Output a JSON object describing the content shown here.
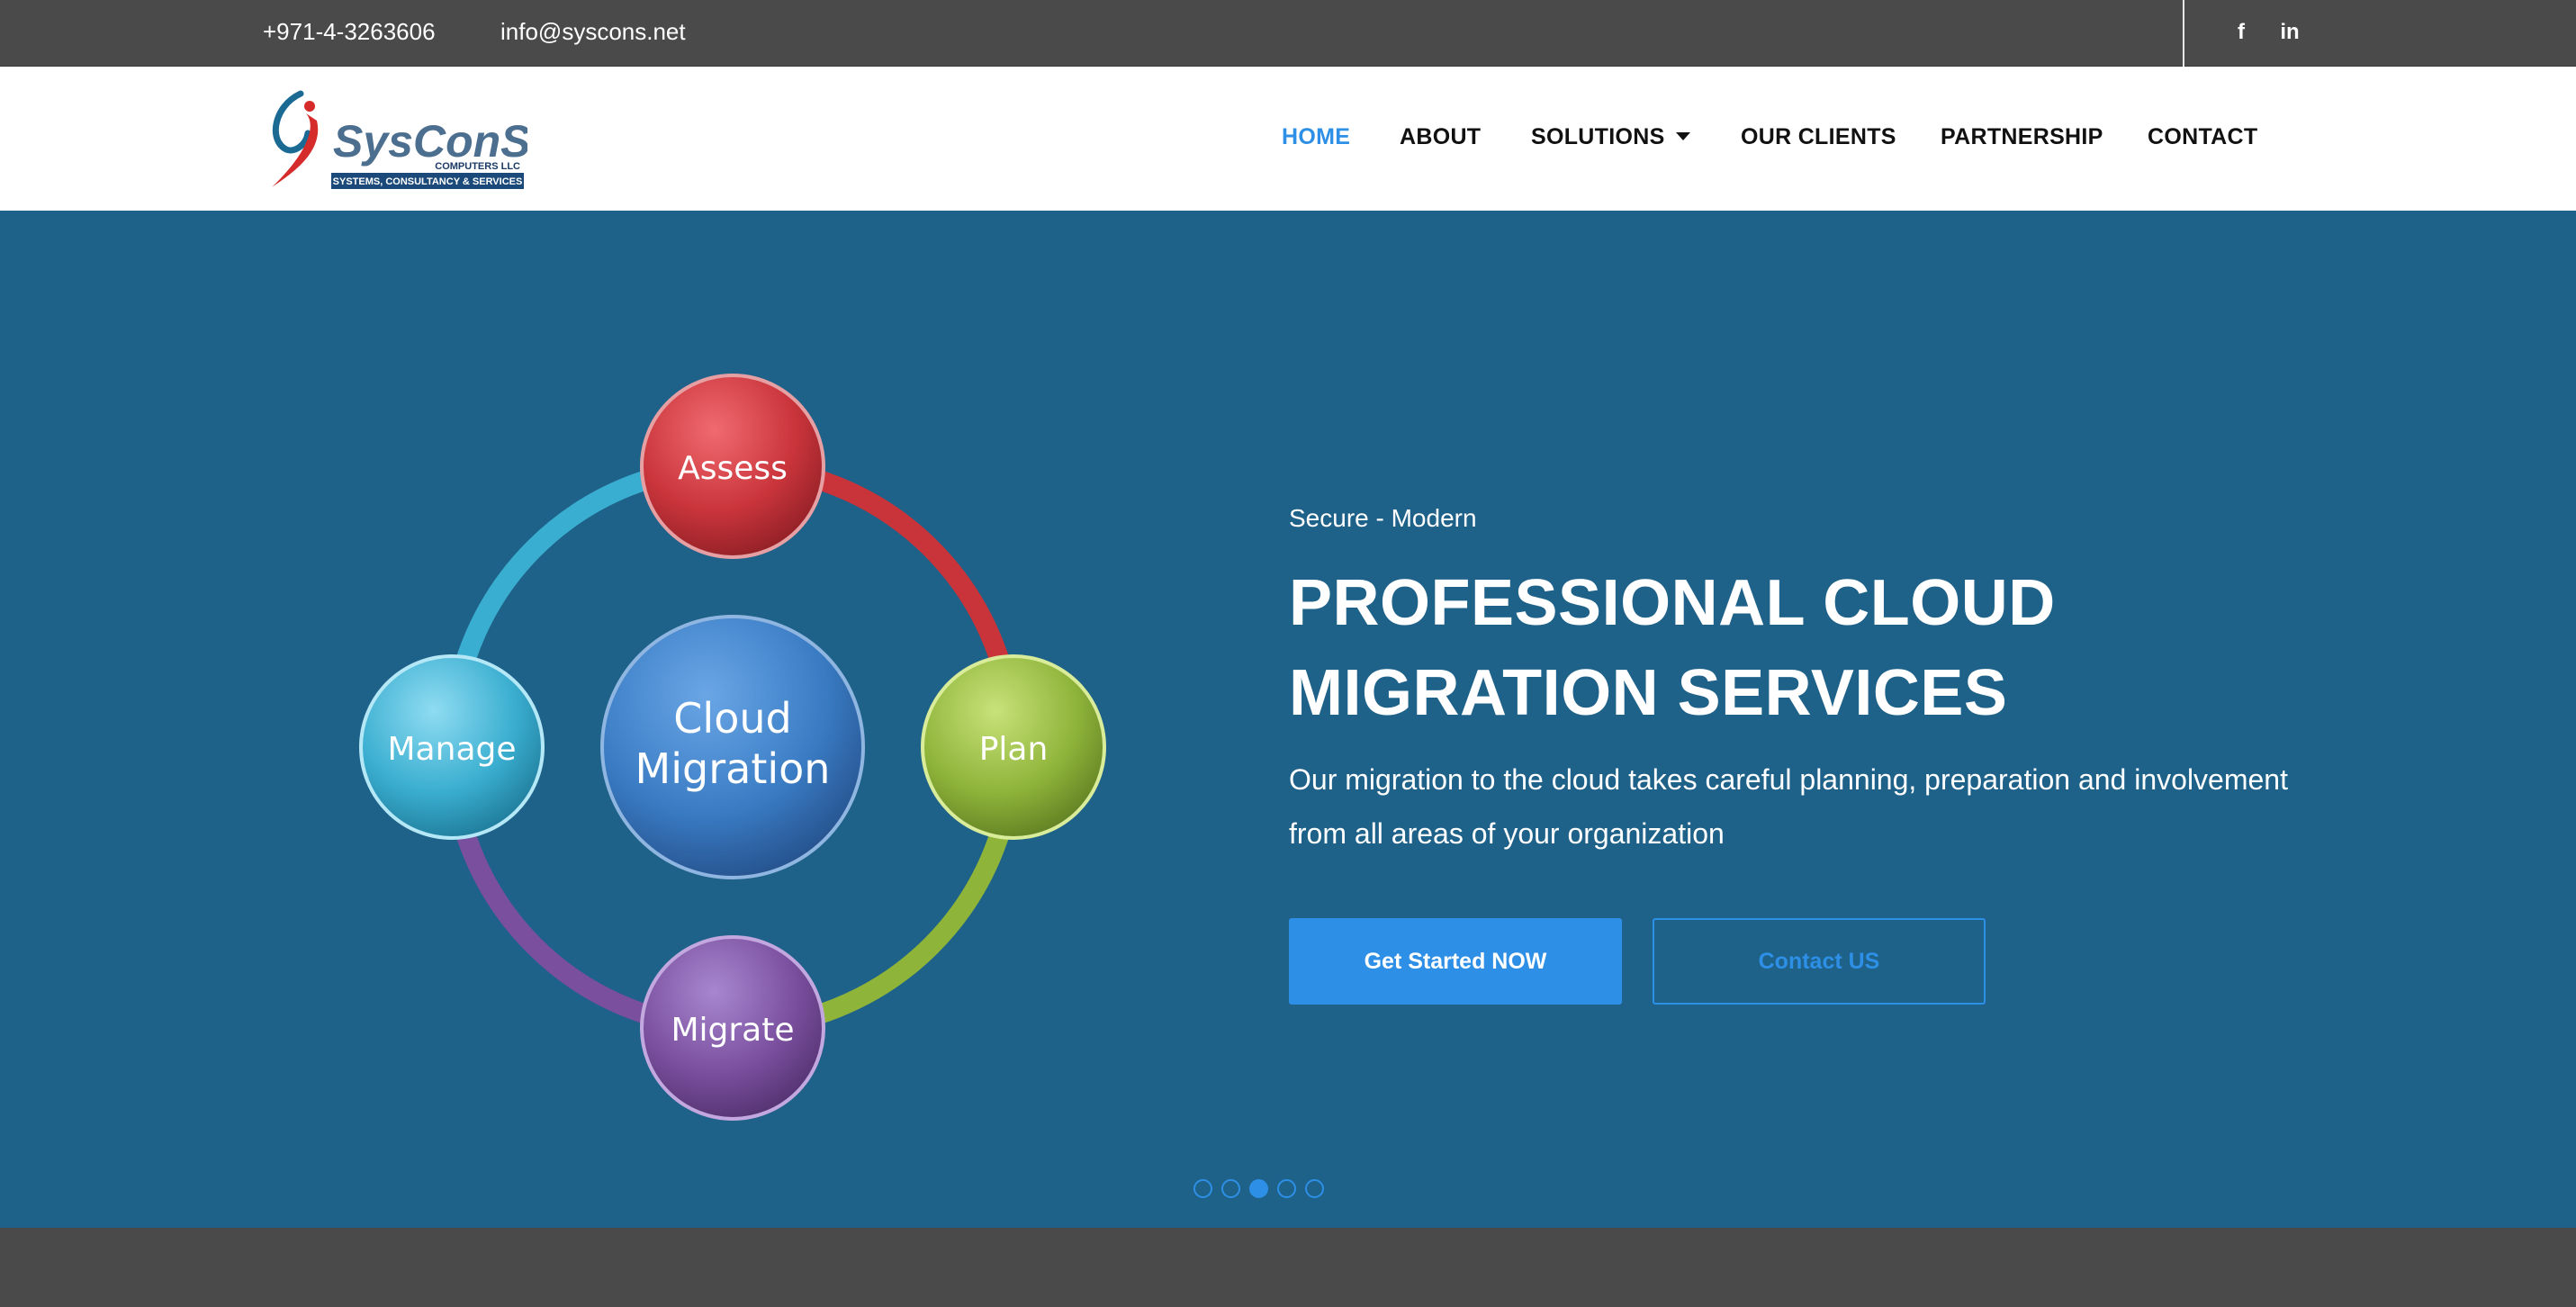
{
  "topbar": {
    "phone": "+971-4-3263606",
    "email": "info@syscons.net",
    "social": [
      {
        "icon": "facebook-icon",
        "glyph": "f"
      },
      {
        "icon": "linkedin-icon",
        "glyph": "in"
      }
    ]
  },
  "logo": {
    "name": "SysConS",
    "company": "COMPUTERS LLC",
    "tagline": "SYSTEMS, CONSULTANCY & SERVICES"
  },
  "nav": {
    "home": "HOME",
    "about": "ABOUT",
    "solutions": "SOLUTIONS",
    "clients": "OUR CLIENTS",
    "partnership": "PARTNERSHIP",
    "contact": "CONTACT",
    "active": "home"
  },
  "hero": {
    "tagline": "Secure - Modern",
    "headline": "PROFESSIONAL CLOUD MIGRATION SERVICES",
    "description": "Our migration to the cloud takes careful planning, preparation and involvement from all areas of your organization",
    "primary_button": "Get Started NOW",
    "secondary_button": "Contact US",
    "diagram": {
      "center_line1": "Cloud",
      "center_line2": "Migration",
      "assess": "Assess",
      "plan": "Plan",
      "migrate": "Migrate",
      "manage": "Manage"
    },
    "slider": {
      "total": 5,
      "active_index": 2
    }
  },
  "colors": {
    "topbar_bg": "#4a4a4a",
    "hero_bg": "#1e6189",
    "accent": "#2d8fe6",
    "assess": "#c9343b",
    "plan": "#8fb43a",
    "migrate": "#7a4f9e",
    "manage": "#3aaed0",
    "center": "#3a7cc4"
  }
}
